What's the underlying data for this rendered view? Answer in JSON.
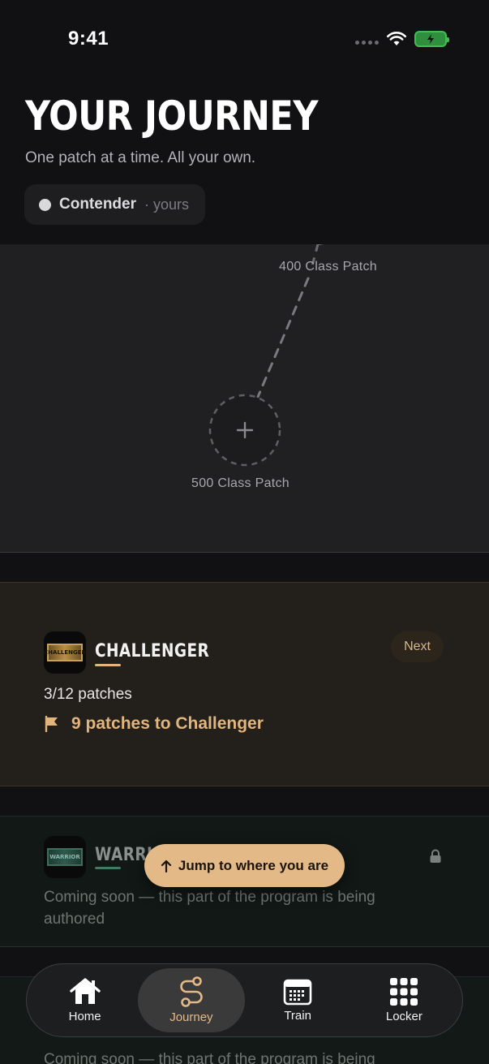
{
  "status_bar": {
    "time": "9:41"
  },
  "header": {
    "title": "YOUR JOURNEY",
    "subtitle": "One patch at a time. All your own.",
    "rank_name": "Contender",
    "rank_suffix": "· yours"
  },
  "map": {
    "nodes": [
      {
        "label": "400 Class Patch"
      },
      {
        "label": "500 Class Patch"
      }
    ]
  },
  "tiers": [
    {
      "name": "CHALLENGER",
      "badge_text": "CHALLENGER",
      "status_pill": "Next",
      "progress": "3/12 patches",
      "progress_fraction": 0.25,
      "goal": "9 patches to Challenger",
      "accent": "#e0b57e"
    },
    {
      "name": "WARRIOR",
      "badge_text": "WARRIOR",
      "description": "Coming soon — this part of the program is being authored",
      "locked": true,
      "accent": "#3f7a62"
    },
    {
      "description": "Coming soon — this part of the program is being"
    }
  ],
  "jump_button": {
    "label": "Jump to where you are"
  },
  "tabbar": {
    "items": [
      {
        "label": "Home",
        "icon": "home-icon"
      },
      {
        "label": "Journey",
        "icon": "route-icon",
        "active": true
      },
      {
        "label": "Train",
        "icon": "calendar-icon"
      },
      {
        "label": "Locker",
        "icon": "grid-icon"
      }
    ]
  },
  "colors": {
    "accent": "#e3b987",
    "background": "#111113",
    "map_background": "#202023",
    "battery": "#3fbf52"
  }
}
